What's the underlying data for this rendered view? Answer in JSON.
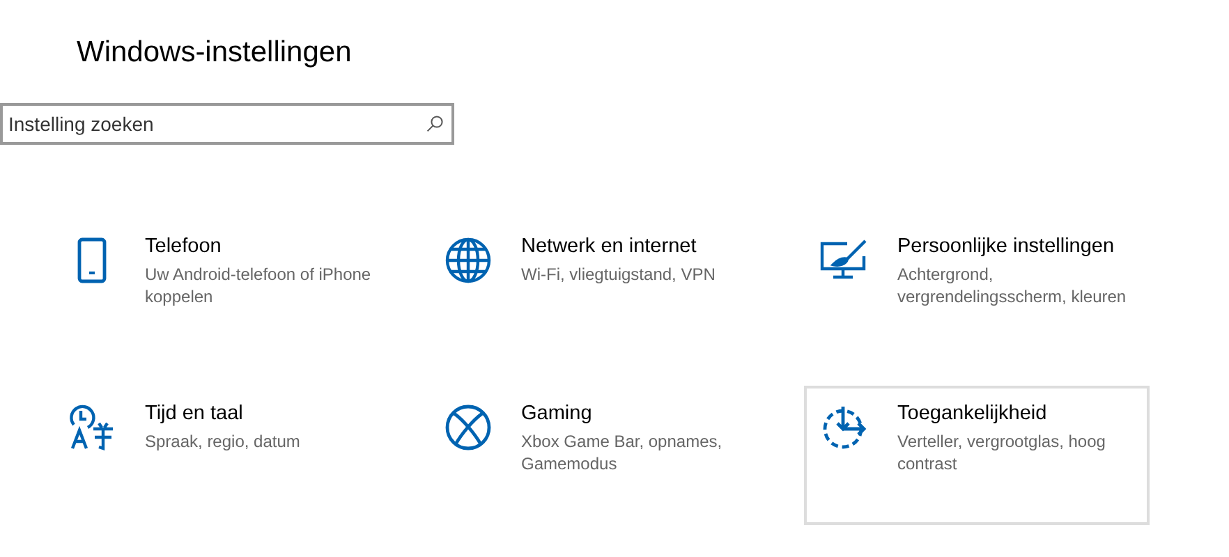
{
  "window": {
    "title": "Windows-instellingen"
  },
  "search": {
    "placeholder": "Instelling zoeken"
  },
  "tiles": [
    {
      "kind": "phone",
      "title": "Telefoon",
      "description": "Uw Android-telefoon of iPhone koppelen",
      "hovered": false
    },
    {
      "kind": "globe",
      "title": "Netwerk en internet",
      "description": "Wi-Fi, vliegtuigstand, VPN",
      "hovered": false
    },
    {
      "kind": "paint",
      "title": "Persoonlijke instellingen",
      "description": "Achtergrond, vergrendelingsscherm, kleuren",
      "hovered": false
    },
    {
      "kind": "language",
      "title": "Tijd en taal",
      "description": "Spraak, regio, datum",
      "hovered": false
    },
    {
      "kind": "xbox",
      "title": "Gaming",
      "description": "Xbox Game Bar, opnames, Gamemodus",
      "hovered": false
    },
    {
      "kind": "access",
      "title": "Toegankelijkheid",
      "description": "Verteller, vergrootglas, hoog contrast",
      "hovered": true
    }
  ]
}
